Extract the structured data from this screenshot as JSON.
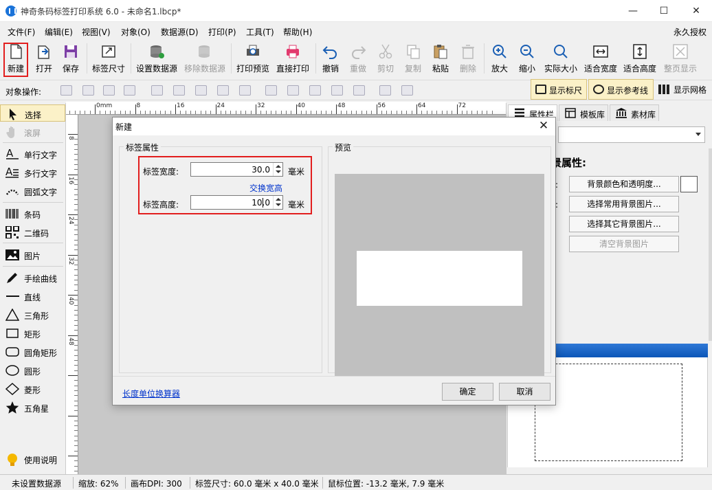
{
  "app": {
    "title": "神奇条码标签打印系统 6.0 - 未命名1.lbcp*",
    "window_controls": [
      "—",
      "☐",
      "✕"
    ],
    "accent_color": "#1a73d9",
    "highlight_color": "#e21d1d"
  },
  "menu": {
    "items": [
      "文件(F)",
      "编辑(E)",
      "视图(V)",
      "对象(O)",
      "数据源(D)",
      "打印(P)",
      "工具(T)",
      "帮助(H)"
    ],
    "license": "永久授权"
  },
  "toolbar": {
    "buttons": [
      {
        "label": "新建",
        "icon": "new-file-icon",
        "enabled": true
      },
      {
        "label": "打开",
        "icon": "open-file-icon",
        "enabled": true
      },
      {
        "label": "保存",
        "icon": "save-icon",
        "enabled": true
      },
      {
        "label": "标签尺寸",
        "icon": "label-size-icon",
        "enabled": true
      },
      {
        "label": "设置数据源",
        "icon": "database-settings-icon",
        "enabled": true
      },
      {
        "label": "移除数据源",
        "icon": "database-remove-icon",
        "enabled": false
      },
      {
        "label": "打印预览",
        "icon": "print-preview-icon",
        "enabled": true
      },
      {
        "label": "直接打印",
        "icon": "printer-icon",
        "enabled": true
      },
      {
        "label": "撤销",
        "icon": "undo-icon",
        "enabled": true
      },
      {
        "label": "重做",
        "icon": "redo-icon",
        "enabled": false
      },
      {
        "label": "剪切",
        "icon": "cut-icon",
        "enabled": false
      },
      {
        "label": "复制",
        "icon": "copy-icon",
        "enabled": false
      },
      {
        "label": "粘贴",
        "icon": "paste-icon",
        "enabled": true
      },
      {
        "label": "删除",
        "icon": "delete-icon",
        "enabled": false
      },
      {
        "label": "放大",
        "icon": "zoom-in-icon",
        "enabled": true
      },
      {
        "label": "缩小",
        "icon": "zoom-out-icon",
        "enabled": true
      },
      {
        "label": "实际大小",
        "icon": "actual-size-icon",
        "enabled": true
      },
      {
        "label": "适合宽度",
        "icon": "fit-width-icon",
        "enabled": true
      },
      {
        "label": "适合高度",
        "icon": "fit-height-icon",
        "enabled": true
      },
      {
        "label": "整页显示",
        "icon": "full-page-icon",
        "enabled": false
      }
    ]
  },
  "objectbar": {
    "label": "对象操作:",
    "show_ruler": "显示标尺",
    "show_guides": "显示参考线",
    "show_grid": "显示网格"
  },
  "tools": {
    "items": [
      {
        "label": "选择",
        "icon": "pointer-icon",
        "enabled": true
      },
      {
        "label": "滚屏",
        "icon": "hand-icon",
        "enabled": false
      },
      {
        "label": "单行文字",
        "icon": "single-line-text-icon",
        "enabled": true
      },
      {
        "label": "多行文字",
        "icon": "multi-line-text-icon",
        "enabled": true
      },
      {
        "label": "圆弧文字",
        "icon": "arc-text-icon",
        "enabled": true
      },
      {
        "label": "条码",
        "icon": "barcode-icon",
        "enabled": true
      },
      {
        "label": "二维码",
        "icon": "qrcode-icon",
        "enabled": true
      },
      {
        "label": "图片",
        "icon": "image-icon",
        "enabled": true
      },
      {
        "label": "手绘曲线",
        "icon": "pen-icon",
        "enabled": true
      },
      {
        "label": "直线",
        "icon": "line-icon",
        "enabled": true
      },
      {
        "label": "三角形",
        "icon": "triangle-icon",
        "enabled": true
      },
      {
        "label": "矩形",
        "icon": "rectangle-icon",
        "enabled": true
      },
      {
        "label": "圆角矩形",
        "icon": "rounded-rectangle-icon",
        "enabled": true
      },
      {
        "label": "圆形",
        "icon": "ellipse-icon",
        "enabled": true
      },
      {
        "label": "菱形",
        "icon": "diamond-icon",
        "enabled": true
      },
      {
        "label": "五角星",
        "icon": "star-icon",
        "enabled": true
      }
    ],
    "help": "使用说明"
  },
  "ruler": {
    "h_labels": [
      "8",
      "0mm",
      "8",
      "16",
      "24",
      "32",
      "40",
      "48",
      "56",
      "64",
      "72"
    ],
    "v_labels": [
      "8",
      "16",
      "24",
      "32",
      "40",
      "48"
    ]
  },
  "rightpanel": {
    "tabs": [
      "属性栏",
      "模板库",
      "素材库"
    ],
    "heading": "景属性:",
    "buttons": [
      "背景颜色和透明度...",
      "选择常用背景图片...",
      "选择其它背景图片...",
      "清空背景图片"
    ]
  },
  "dialog": {
    "title": "新建",
    "group_label_props": "标签属性",
    "group_label_preview": "预览",
    "width_label": "标签宽度:",
    "width_value": "30.0",
    "height_label": "标签高度:",
    "height_value": "10.0",
    "unit": "毫米",
    "swap_link": "交换宽高",
    "calc_link": "长度单位换算器",
    "ok": "确定",
    "cancel": "取消"
  },
  "status": {
    "datasource": "未设置数据源",
    "zoom": "缩放: 62%",
    "dpi": "画布DPI: 300",
    "label_size": "标签尺寸: 60.0 毫米 x 40.0 毫米",
    "mouse": "鼠标位置: -13.2 毫米, 7.9 毫米"
  }
}
